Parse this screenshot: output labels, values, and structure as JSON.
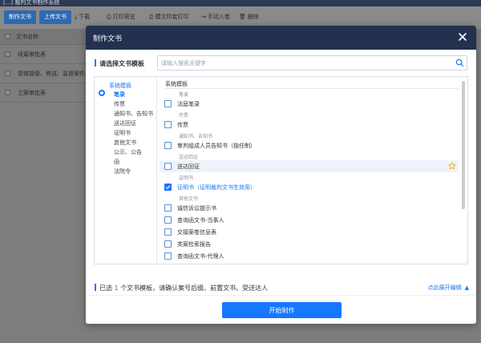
{
  "app": {
    "title": "[...] 裁判文书制作系统",
    "toolbar": {
      "make_doc": "制作文书",
      "upload_doc": "上传文书",
      "download": "下载",
      "print_preview": "打印预览",
      "print_setting": "模文印套打印",
      "manual_store": "手动入卷",
      "delete": "删除"
    },
    "table": {
      "header": "文书名称",
      "rows": [
        "续篇审批表",
        "管辖提级、移送、监督案件",
        "立案审批表"
      ]
    }
  },
  "modal": {
    "title": "制作文书",
    "select_template_label": "请选择文书模板",
    "search": {
      "placeholder": "请输入搜索关键字"
    },
    "tree": {
      "root": "系统模板",
      "items": [
        "笔录",
        "传票",
        "通知书、告知书",
        "送达回证",
        "证明书",
        "其他文书",
        "公示、公告",
        "函",
        "法院令"
      ]
    },
    "list": {
      "heading": "系统模板",
      "groups": [
        {
          "name": "笔录",
          "items": [
            {
              "label": "法庭笔录",
              "checked": false
            }
          ]
        },
        {
          "name": "传票",
          "items": [
            {
              "label": "传票",
              "checked": false
            }
          ]
        },
        {
          "name": "通知书、告知书",
          "items": [
            {
              "label": "审判组成人员告知书（独任制）",
              "checked": false
            }
          ]
        },
        {
          "name": "送达回证",
          "items": [
            {
              "label": "送达回证",
              "checked": false,
              "highlighted": true,
              "starred": true
            }
          ]
        },
        {
          "name": "证明书",
          "items": [
            {
              "label": "证明书（证明裁判文书生效用）",
              "checked": true
            }
          ]
        },
        {
          "name": "其他文书",
          "items": [
            {
              "label": "诚信诉讼提示书",
              "checked": false
            },
            {
              "label": "查询函文书-当事人",
              "checked": false
            },
            {
              "label": "交接案卷信息表",
              "checked": false
            },
            {
              "label": "类案检索报告",
              "checked": false
            },
            {
              "label": "查询函文书-代理人",
              "checked": false
            }
          ]
        }
      ]
    },
    "footer": {
      "prefix": "已选",
      "count": "1",
      "suffix": "个文书模板，请确认案号后缀、前置文书、受送达人",
      "toggle": "点此展开编辑",
      "start_button": "开始制作"
    },
    "colors": {
      "accent": "#1677ff",
      "header": "#23314f",
      "star": "#f5a623"
    },
    "icons": {
      "close": "close-icon",
      "search": "search-icon",
      "star": "star-icon",
      "check": "check-icon",
      "caret": "caret-up-icon"
    }
  }
}
